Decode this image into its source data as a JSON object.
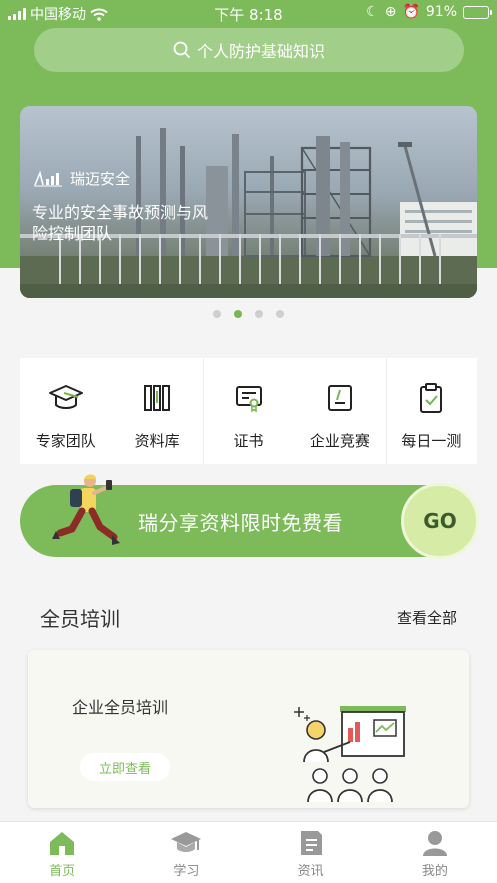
{
  "status_bar": {
    "carrier": "中国移动",
    "time": "下午 8:18",
    "battery": "91%",
    "battery_level": 0.91
  },
  "search": {
    "placeholder": "个人防护基础知识",
    "icon": "search-icon"
  },
  "banner": {
    "brand": "瑞迈安全",
    "slogan": "专业的安全事故预测与风险控制团队",
    "pages": 4,
    "active_page": 2
  },
  "functions": [
    {
      "label": "专家团队",
      "icon": "graduation-cap-icon"
    },
    {
      "label": "资料库",
      "icon": "books-icon"
    },
    {
      "label": "证书",
      "icon": "certificate-icon"
    },
    {
      "label": "企业竞赛",
      "icon": "contest-icon"
    },
    {
      "label": "每日一测",
      "icon": "clipboard-check-icon"
    }
  ],
  "promo": {
    "text": "瑞分享资料限时免费看",
    "button": "GO"
  },
  "training": {
    "title": "全员培训",
    "more": "查看全部",
    "card": {
      "title": "企业全员培训",
      "button": "立即查看"
    }
  },
  "tabbar": [
    {
      "label": "首页",
      "icon": "home-icon",
      "active": true
    },
    {
      "label": "学习",
      "icon": "study-cap-icon",
      "active": false
    },
    {
      "label": "资讯",
      "icon": "news-icon",
      "active": false
    },
    {
      "label": "我的",
      "icon": "user-icon",
      "active": false
    }
  ],
  "colors": {
    "brand_green": "#7dbb5a",
    "go_button": "#d5eba6"
  }
}
